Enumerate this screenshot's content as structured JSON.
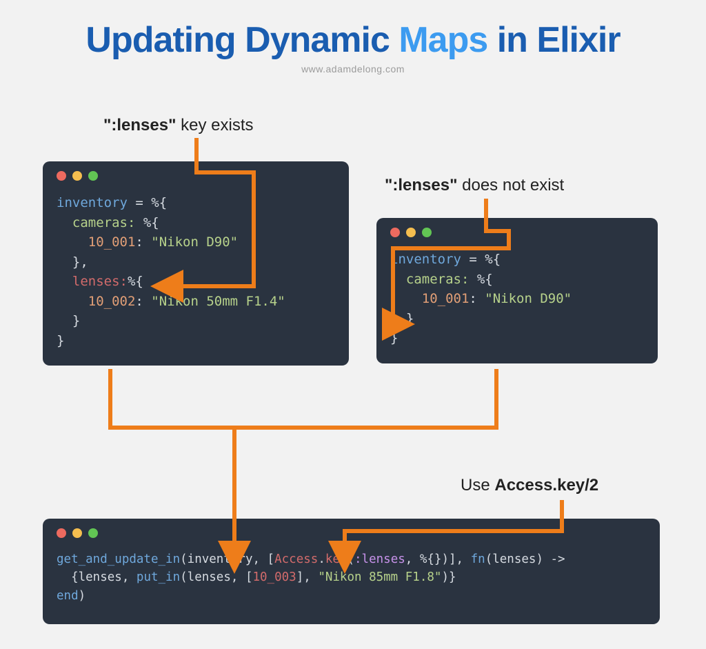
{
  "title": {
    "part1": "Updating Dynamic ",
    "part2": "Maps",
    "part3": " in Elixir"
  },
  "subtitle": "www.adamdelong.com",
  "labels": {
    "exists_bold": "\":lenses\"",
    "exists_rest": " key exists",
    "notexist_bold": "\":lenses\"",
    "notexist_rest": " does not exist",
    "use_prefix": "Use ",
    "use_bold": "Access.key/2"
  },
  "code1": {
    "l1a": "inventory",
    "l1b": " = %{",
    "l2a": "  cameras: ",
    "l2b": "%{",
    "l3a": "    10_001",
    "l3b": ": ",
    "l3c": "\"Nikon D90\"",
    "l4": "  },",
    "l5a": "  lenses:",
    "l5b": "%{",
    "l6a": "    10_002",
    "l6b": ": ",
    "l6c": "\"Nikon 50mm F1.4\"",
    "l7": "  }",
    "l8": "}"
  },
  "code2": {
    "l1a": "inventory",
    "l1b": " = %{",
    "l2a": "  cameras: ",
    "l2b": "%{",
    "l3a": "    10_001",
    "l3b": ": ",
    "l3c": "\"Nikon D90\"",
    "l4": "  }",
    "l5": "}"
  },
  "code3": {
    "l1a": "get_and_update_in",
    "l1b": "(inventory, [",
    "l1c": "Access",
    "l1d": ".",
    "l1e": "key",
    "l1f": "(",
    "l1g": ":lenses",
    "l1h": ", %{})], ",
    "l1i": "fn",
    "l1j": "(lenses) ->",
    "l2a": "  {lenses, ",
    "l2b": "put_in",
    "l2c": "(lenses, [",
    "l2d": "10_003",
    "l2e": "], ",
    "l2f": "\"Nikon 85mm F1.8\"",
    "l2g": ")}",
    "l3a": "end",
    "l3b": ")"
  }
}
